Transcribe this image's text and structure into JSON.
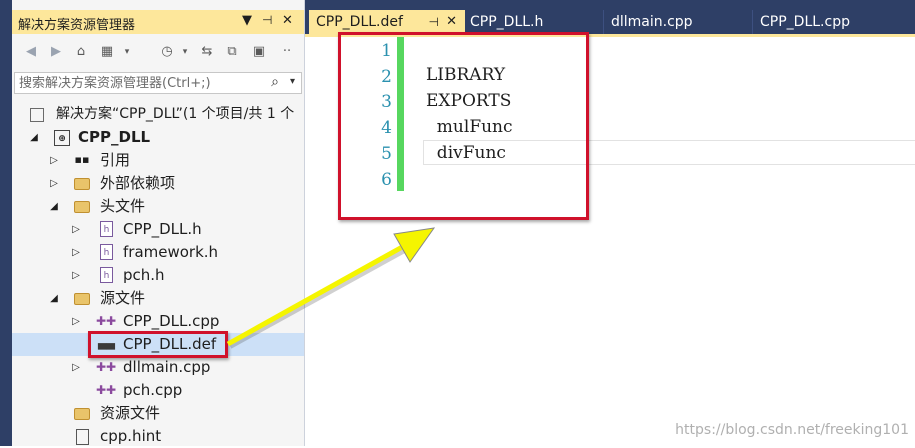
{
  "colors": {
    "frame_dark": "#2e3f66",
    "active_tab": "#fde79b",
    "selection": "#cce0f7",
    "change_bar": "#57d75f",
    "line_number": "#2b91af",
    "annotation_red": "#d0112b",
    "annotation_arrow": "#f5f500"
  },
  "solution_explorer": {
    "title": "解决方案资源管理器",
    "title_controls": [
      "▼",
      "ᵖ",
      "✕"
    ],
    "toolbar_icons": [
      "back-icon",
      "forward-icon",
      "home-icon",
      "vs-switch-icon",
      "history-icon",
      "sync-icon",
      "collapse-icon",
      "properties-icon",
      "more-icon"
    ],
    "search_placeholder": "搜索解决方案资源管理器(Ctrl+;)",
    "tree": [
      {
        "label": "解决方案“CPP_DLL”(1 个项目/共 1 个",
        "icon": "solution-icon"
      },
      {
        "label": "CPP_DLL",
        "icon": "project-icon",
        "expanded": true
      },
      {
        "label": "引用",
        "icon": "references-icon",
        "expanded": false
      },
      {
        "label": "外部依赖项",
        "icon": "external-deps-icon",
        "expanded": false
      },
      {
        "label": "头文件",
        "icon": "folder-icon",
        "expanded": true
      },
      {
        "label": "CPP_DLL.h",
        "icon": "header-file-icon",
        "expanded": false
      },
      {
        "label": "framework.h",
        "icon": "header-file-icon",
        "expanded": false
      },
      {
        "label": "pch.h",
        "icon": "header-file-icon",
        "expanded": false
      },
      {
        "label": "源文件",
        "icon": "folder-icon",
        "expanded": true
      },
      {
        "label": "CPP_DLL.cpp",
        "icon": "cpp-file-icon",
        "expanded": false
      },
      {
        "label": "CPP_DLL.def",
        "icon": "def-file-icon",
        "selected": true
      },
      {
        "label": "dllmain.cpp",
        "icon": "cpp-file-icon",
        "expanded": false
      },
      {
        "label": "pch.cpp",
        "icon": "cpp-file-icon"
      },
      {
        "label": "资源文件",
        "icon": "folder-icon"
      },
      {
        "label": "cpp.hint",
        "icon": "hint-file-icon"
      }
    ]
  },
  "editor": {
    "tabs": [
      {
        "label": "CPP_DLL.def",
        "active": true,
        "pin": "⊣",
        "close": "✕"
      },
      {
        "label": "CPP_DLL.h"
      },
      {
        "label": "dllmain.cpp"
      },
      {
        "label": "CPP_DLL.cpp"
      }
    ],
    "line_numbers": [
      "1",
      "2",
      "3",
      "4",
      "5",
      "6"
    ],
    "lines": [
      "",
      "LIBRARY",
      "EXPORTS",
      "  mulFunc",
      "  divFunc",
      ""
    ]
  },
  "watermark": "https://blog.csdn.net/freeking101"
}
